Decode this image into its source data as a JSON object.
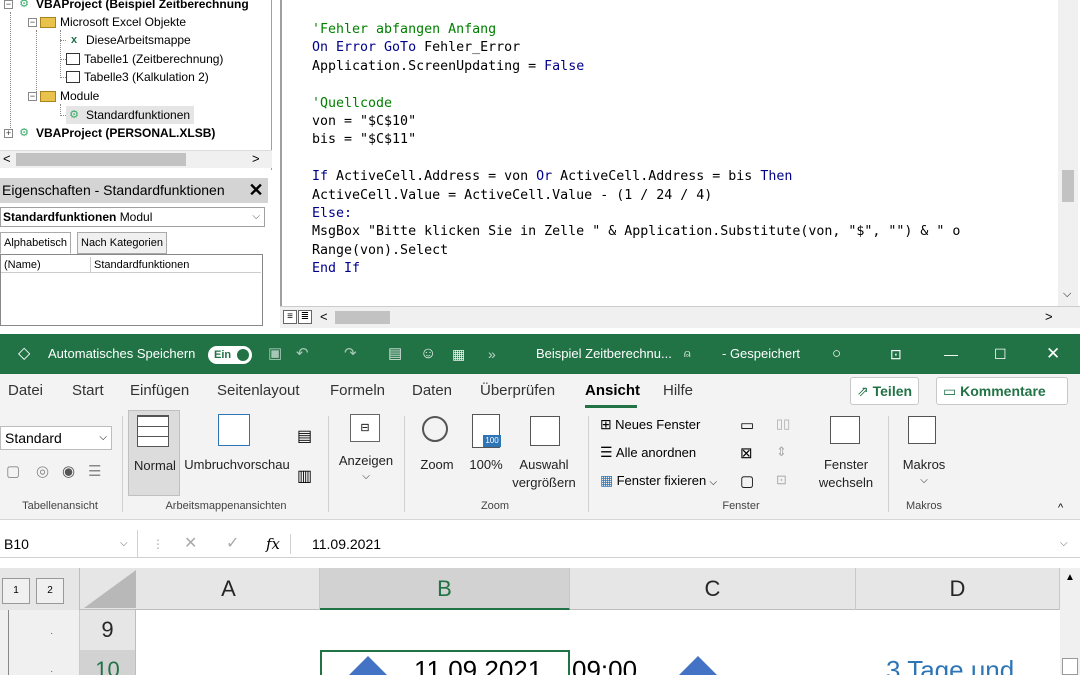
{
  "vba": {
    "project_tree": [
      {
        "label": "VBAProject (Beispiel Zeitberechnung",
        "bold": true
      },
      {
        "label": "Microsoft Excel Objekte"
      },
      {
        "label": "DieseArbeitsmappe"
      },
      {
        "label": "Tabelle1 (Zeitberechnung)"
      },
      {
        "label": "Tabelle3 (Kalkulation 2)"
      },
      {
        "label": "Module"
      },
      {
        "label": "Standardfunktionen"
      },
      {
        "label": "VBAProject (PERSONAL.XLSB)",
        "bold": true
      }
    ],
    "properties": {
      "title": "Eigenschaften - Standardfunktionen",
      "close": "✕",
      "combo_name": "Standardfunktionen",
      "combo_type": "Modul",
      "tab_alpha": "Alphabetisch",
      "tab_cat": "Nach Kategorien",
      "row_key": "(Name)",
      "row_val": "Standardfunktionen"
    },
    "code_lines": [
      {
        "text": "'Fehler abfangen Anfang",
        "cls": "cm"
      },
      {
        "parts": [
          {
            "t": "On Error GoTo",
            "c": "kw"
          },
          {
            "t": " Fehler_Error",
            "c": ""
          }
        ]
      },
      {
        "parts": [
          {
            "t": "Application.ScreenUpdating = ",
            "c": ""
          },
          {
            "t": "False",
            "c": "kw"
          }
        ]
      },
      {
        "text": "",
        "cls": ""
      },
      {
        "text": "'Quellcode",
        "cls": "cm"
      },
      {
        "text": "von = \"$C$10\"",
        "cls": ""
      },
      {
        "text": "bis = \"$C$11\"",
        "cls": ""
      },
      {
        "text": "",
        "cls": ""
      },
      {
        "parts": [
          {
            "t": "If",
            "c": "kw"
          },
          {
            "t": " ActiveCell.Address = von ",
            "c": ""
          },
          {
            "t": "Or",
            "c": "kw"
          },
          {
            "t": " ActiveCell.Address = bis ",
            "c": ""
          },
          {
            "t": "Then",
            "c": "kw"
          }
        ]
      },
      {
        "text": "ActiveCell.Value = ActiveCell.Value - (1 / 24 / 4)",
        "cls": ""
      },
      {
        "parts": [
          {
            "t": "Else:",
            "c": "kw"
          }
        ]
      },
      {
        "text": "MsgBox \"Bitte klicken Sie in Zelle \" & Application.Substitute(von, \"$\", \"\") & \" o",
        "cls": ""
      },
      {
        "text": "Range(von).Select",
        "cls": ""
      },
      {
        "parts": [
          {
            "t": "End If",
            "c": "kw"
          }
        ]
      }
    ]
  },
  "excel": {
    "title_bar": {
      "autosave_label": "Automatisches Speichern",
      "autosave_state": "Ein",
      "doc_title": "Beispiel Zeitberechnu...",
      "save_status": "- Gespeichert",
      "more": "»"
    },
    "tabs": [
      "Datei",
      "Start",
      "Einfügen",
      "Seitenlayout",
      "Formeln",
      "Daten",
      "Überprüfen",
      "Ansicht",
      "Hilfe"
    ],
    "active_tab": "Ansicht",
    "share": "Teilen",
    "comments": "Kommentare",
    "ribbon": {
      "sheet_view_select": "Standard",
      "group_sheet_view": "Tabellenansicht",
      "normal": "Normal",
      "pagebreak": "Umbruchvorschau",
      "group_views": "Arbeitsmappenansichten",
      "show": "Anzeigen",
      "zoom": "Zoom",
      "zoom100": "100%",
      "zoom_sel_1": "Auswahl",
      "zoom_sel_2": "vergrößern",
      "group_zoom": "Zoom",
      "new_window": "Neues Fenster",
      "arrange_all": "Alle anordnen",
      "freeze": "Fenster fixieren",
      "switch_1": "Fenster",
      "switch_2": "wechseln",
      "group_window": "Fenster",
      "macros": "Makros",
      "group_macros": "Makros"
    },
    "namebox": "B10",
    "formula": "11.09.2021",
    "columns": [
      "A",
      "B",
      "C",
      "D"
    ],
    "outline_levels": [
      "1",
      "2"
    ],
    "rows": [
      {
        "num": "9"
      },
      {
        "num": "10",
        "b": "11.09.2021",
        "c": "09:00",
        "d": "3 Tage und"
      }
    ]
  }
}
